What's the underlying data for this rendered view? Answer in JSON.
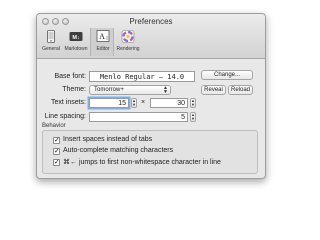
{
  "window": {
    "title": "Preferences"
  },
  "toolbar": {
    "items": [
      {
        "label": "General",
        "icon": "phone-icon"
      },
      {
        "label": "Markdown",
        "icon": "markdown-icon"
      },
      {
        "label": "Editor",
        "icon": "text-icon",
        "selected": true
      },
      {
        "label": "Rendering",
        "icon": "color-wheel-icon"
      }
    ]
  },
  "editor": {
    "base_font_label": "Base font:",
    "base_font_value": "Menlo Regular – 14.0",
    "change_button": "Change...",
    "theme_label": "Theme:",
    "theme_value": "Tomorrow+",
    "reveal_button": "Reveal",
    "reload_button": "Reload",
    "text_insets_label": "Text insets:",
    "inset_x": "15",
    "inset_sep": "×",
    "inset_y": "30",
    "line_spacing_label": "Line spacing:",
    "line_spacing_value": "5"
  },
  "behavior": {
    "title": "Behavior",
    "options": [
      {
        "label": "Insert spaces instead of tabs",
        "checked": true
      },
      {
        "label": "Auto-complete matching characters",
        "checked": true
      },
      {
        "label": "⌘← jumps to first non-whitespace character in line",
        "checked": true
      }
    ]
  }
}
